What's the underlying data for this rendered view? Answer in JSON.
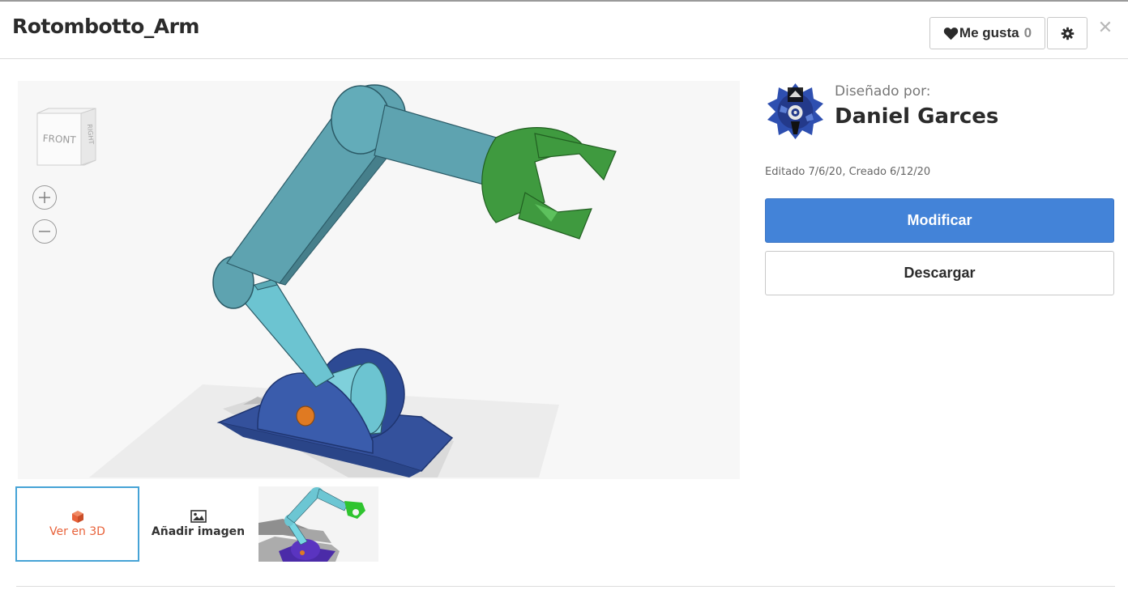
{
  "header": {
    "title": "Rotombotto_Arm",
    "like_label": "Me gusta",
    "like_count": "0"
  },
  "viewer": {
    "viewcube": {
      "front_label": "FRONT",
      "side_label": "RIGHT"
    },
    "icons": {
      "zoom_in": "plus-icon",
      "zoom_out": "minus-icon",
      "settings": "gear-icon",
      "close": "close-icon",
      "like": "heart-icon"
    }
  },
  "thumbnails": {
    "view_3d_label": "Ver en 3D",
    "add_image_label": "Añadir imagen",
    "icons": {
      "view_3d": "cube-icon",
      "add_image": "image-icon"
    }
  },
  "designer": {
    "designed_by_label": "Diseñado por:",
    "name": "Daniel Garces"
  },
  "dates": "Editado 7/6/20, Creado 6/12/20",
  "actions": {
    "modify_label": "Modificar",
    "download_label": "Descargar"
  },
  "colors": {
    "primary_button": "#4383d8",
    "accent_orange": "#e8623a",
    "selected_border": "#46a3d6",
    "arm_teal": "#5ea3b0",
    "gripper_green": "#3f9a3f",
    "base_navy": "#2f4f9c"
  }
}
